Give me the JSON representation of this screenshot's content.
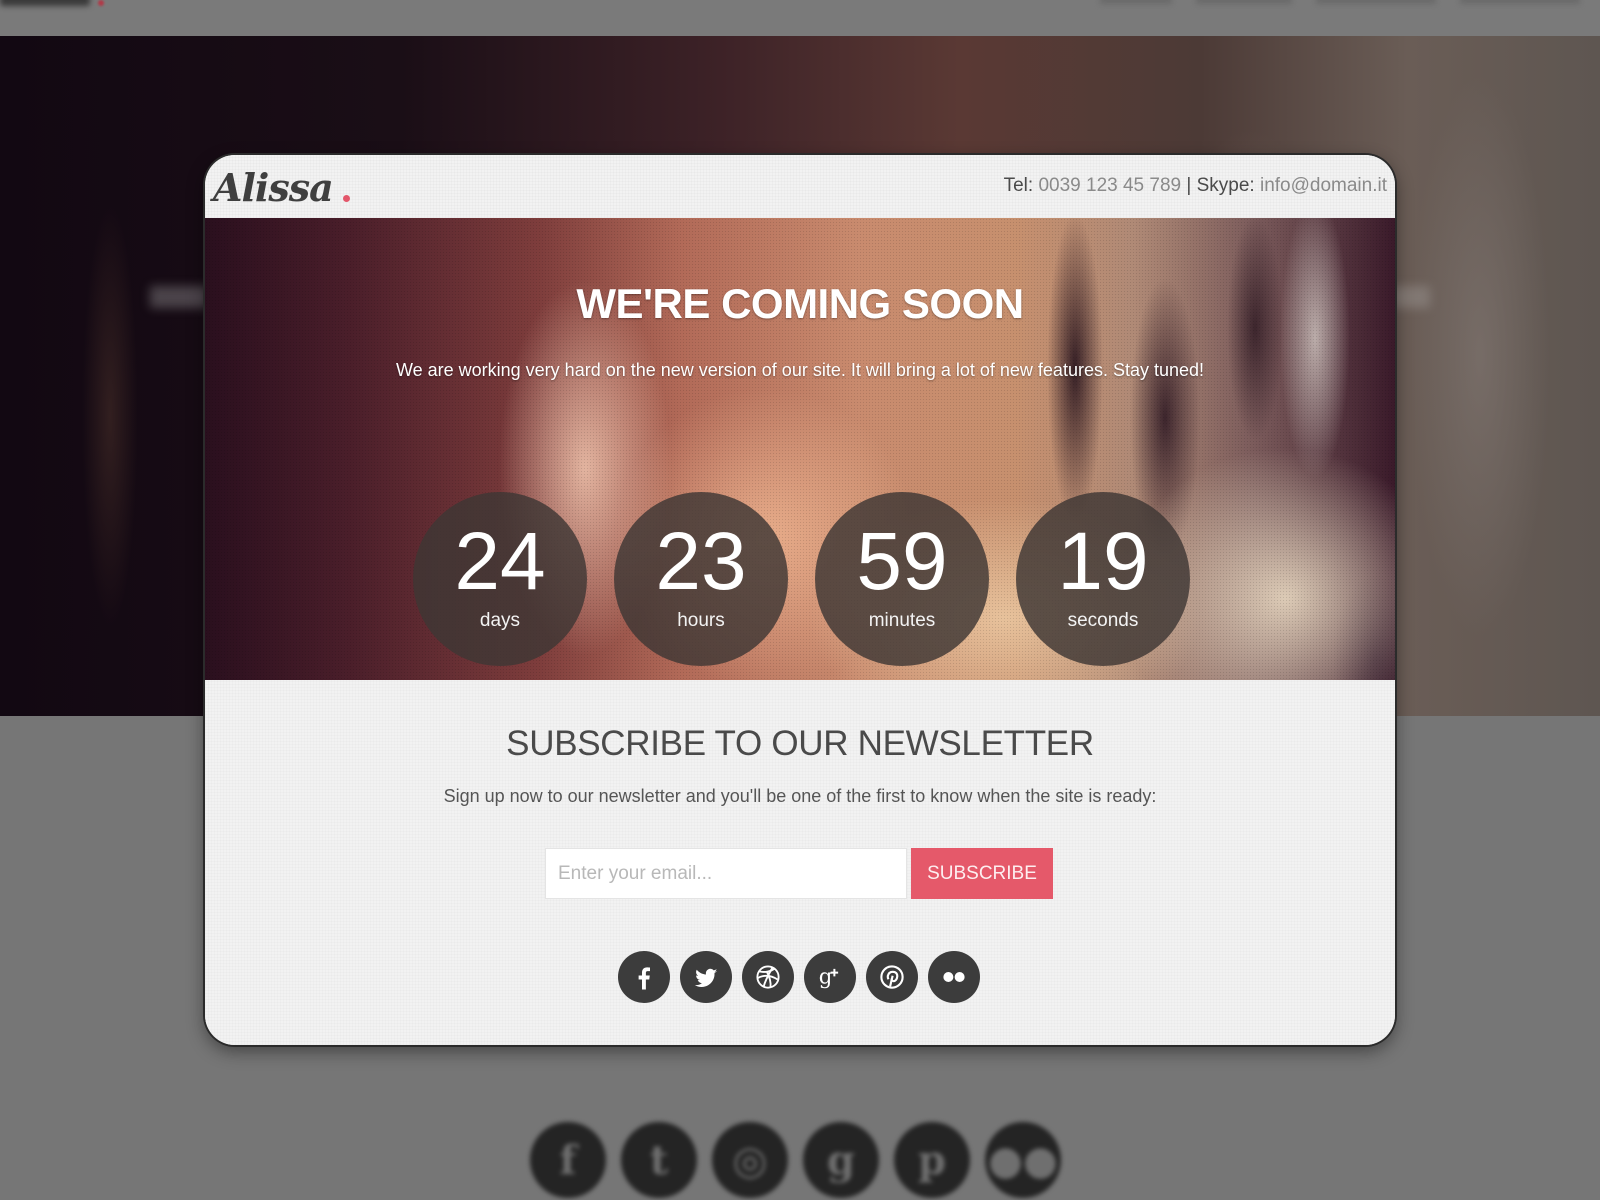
{
  "background_page": {
    "social_icons": [
      "facebook-icon",
      "twitter-icon",
      "dribbble-icon",
      "google-plus-icon",
      "pinterest-icon",
      "flickr-icon"
    ]
  },
  "modal": {
    "brand": {
      "name": "Alissa",
      "accent_color": "#e3566a"
    },
    "contact": {
      "tel_label": "Tel:",
      "tel_value": "0039 123 45 789",
      "separator": "|",
      "skype_label": "Skype:",
      "skype_value": "info@domain.it"
    },
    "hero": {
      "title": "WE'RE COMING SOON",
      "subtitle": "We are working very hard on the new version of our site. It will bring a lot of new features. Stay tuned!",
      "countdown": [
        {
          "value": "24",
          "label": "days"
        },
        {
          "value": "23",
          "label": "hours"
        },
        {
          "value": "59",
          "label": "minutes"
        },
        {
          "value": "19",
          "label": "seconds"
        }
      ]
    },
    "newsletter": {
      "title": "SUBSCRIBE TO OUR NEWSLETTER",
      "subtitle": "Sign up now to our newsletter and you'll be one of the first to know when the site is ready:",
      "email_placeholder": "Enter your email...",
      "email_value": "",
      "subscribe_label": "SUBSCRIBE",
      "button_color": "#e5596a"
    },
    "social": [
      {
        "name": "facebook",
        "icon": "facebook-icon"
      },
      {
        "name": "twitter",
        "icon": "twitter-icon"
      },
      {
        "name": "dribbble",
        "icon": "dribbble-icon"
      },
      {
        "name": "google-plus",
        "icon": "google-plus-icon"
      },
      {
        "name": "pinterest",
        "icon": "pinterest-icon"
      },
      {
        "name": "flickr",
        "icon": "flickr-icon"
      }
    ]
  }
}
